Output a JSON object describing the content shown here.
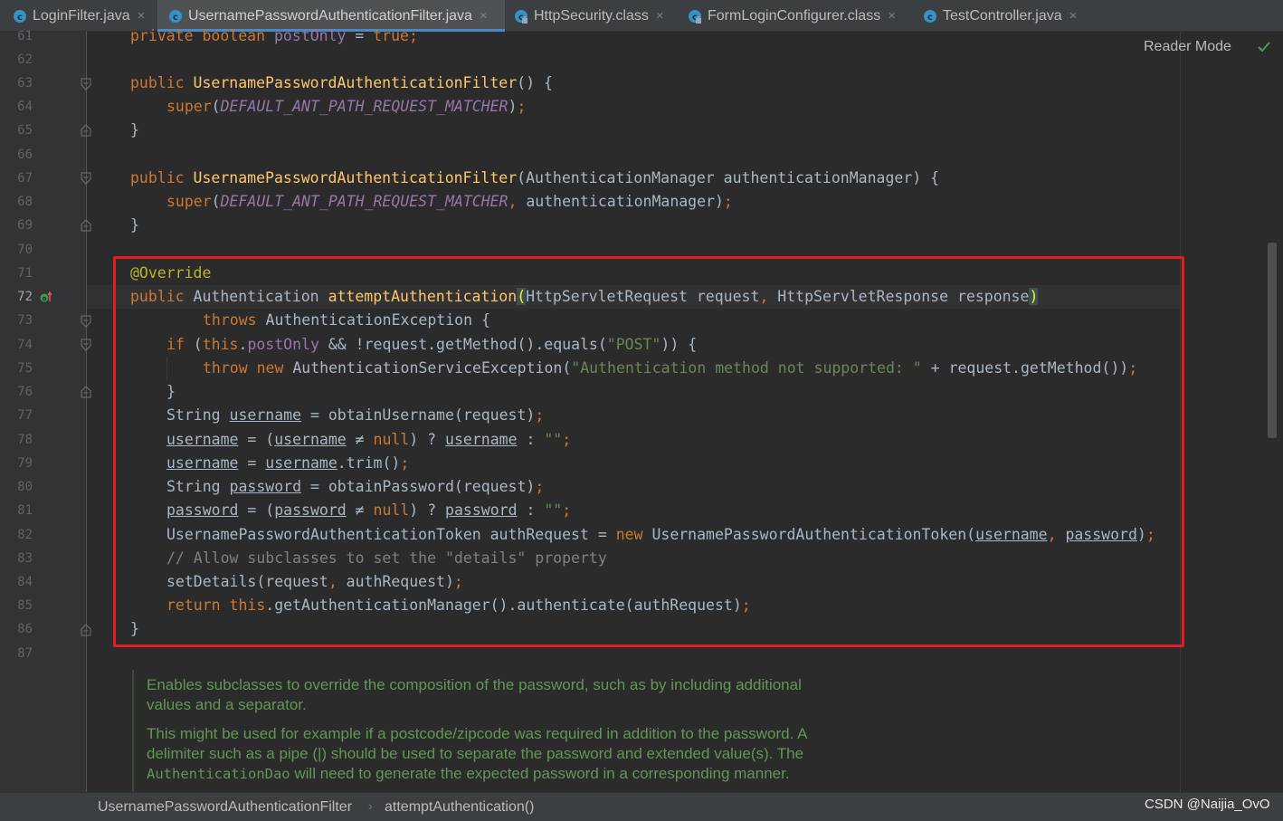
{
  "tabs": [
    {
      "label": "LoginFilter.java",
      "icon": "java-class-icon"
    },
    {
      "label": "UsernamePasswordAuthenticationFilter.java",
      "icon": "java-class-icon",
      "active": true
    },
    {
      "label": "HttpSecurity.class",
      "icon": "compiled-class-icon"
    },
    {
      "label": "FormLoginConfigurer.class",
      "icon": "compiled-class-icon"
    },
    {
      "label": "TestController.java",
      "icon": "java-class-icon"
    }
  ],
  "close_glyph": "×",
  "reader_mode": "Reader Mode",
  "current_line": "72",
  "line_numbers": [
    "61",
    "62",
    "63",
    "64",
    "65",
    "66",
    "67",
    "68",
    "69",
    "70",
    "71",
    "72",
    "73",
    "74",
    "75",
    "76",
    "77",
    "78",
    "79",
    "80",
    "81",
    "82",
    "83",
    "84",
    "85",
    "86",
    "87"
  ],
  "code": {
    "l61": {
      "kw": "private boolean",
      "fld": "postOnly",
      "op": " = ",
      "val": "true",
      "semi": ";"
    },
    "l63": {
      "kw": "public",
      "name": "UsernamePasswordAuthenticationFilter",
      "rest": "() {"
    },
    "l64": {
      "kw": "super",
      "open": "(",
      "const": "DEFAULT_ANT_PATH_REQUEST_MATCHER",
      "close": ")",
      "semi": ";"
    },
    "l65": {
      "text": "}"
    },
    "l67": {
      "kw": "public",
      "name": "UsernamePasswordAuthenticationFilter",
      "rest": "(AuthenticationManager authenticationManager) {"
    },
    "l68": {
      "kw": "super",
      "open": "(",
      "const": "DEFAULT_ANT_PATH_REQUEST_MATCHER",
      "comma": ",",
      "arg": " authenticationManager)",
      "semi": ";"
    },
    "l69": {
      "text": "}"
    },
    "l71": {
      "ann": "@Override"
    },
    "l72": {
      "kw": "public",
      "type": " Authentication ",
      "name": "attemptAuthentication",
      "open": "(",
      "params": "HttpServletRequest request",
      "comma": ",",
      "params2": " HttpServletResponse response",
      "close": ")"
    },
    "l73": {
      "kw": "throws",
      "rest": " AuthenticationException {"
    },
    "l74": {
      "kw": "if",
      "p1": " (",
      "kw2": "this",
      "dot": ".",
      "fld": "postOnly",
      "rest": " && !request.getMethod().equals(",
      "str": "\"POST\"",
      "end": ")) {"
    },
    "l75": {
      "kw": "throw new",
      "rest": " AuthenticationServiceException(",
      "str": "\"Authentication method not supported: \"",
      "rest2": " + request.getMethod())",
      "semi": ";"
    },
    "l76": {
      "text": "}"
    },
    "l77": {
      "type": "String ",
      "var": "username",
      "rest": " = obtainUsername(request)",
      "semi": ";"
    },
    "l78": {
      "var": "username",
      "eq": " = (",
      "var2": "username",
      "ne": " ≠ ",
      "kw": "null",
      "q": ") ? ",
      "var3": "username",
      "c": " : ",
      "str": "\"\"",
      "semi": ";"
    },
    "l79": {
      "var": "username",
      "eq": " = ",
      "var2": "username",
      "rest": ".trim()",
      "semi": ";"
    },
    "l80": {
      "type": "String ",
      "var": "password",
      "rest": " = obtainPassword(request)",
      "semi": ";"
    },
    "l81": {
      "var": "password",
      "eq": " = (",
      "var2": "password",
      "ne": " ≠ ",
      "kw": "null",
      "q": ") ? ",
      "var3": "password",
      "c": " : ",
      "str": "\"\"",
      "semi": ";"
    },
    "l82": {
      "decl": "UsernamePasswordAuthenticationToken authRequest = ",
      "kw": "new",
      "rest": " UsernamePasswordAuthenticationToken(",
      "var": "username",
      "comma": ",",
      "sp": " ",
      "var2": "password",
      "close": ")",
      "semi": ";"
    },
    "l83": {
      "cmt": "// Allow subclasses to set the \"details\" property"
    },
    "l84": {
      "rest": "setDetails(request",
      "comma": ",",
      "rest2": " authRequest)",
      "semi": ";"
    },
    "l85": {
      "kw": "return this",
      "rest": ".getAuthenticationManager().authenticate(authRequest)",
      "semi": ";"
    },
    "l86": {
      "text": "}"
    }
  },
  "doc": {
    "p1": "Enables subclasses to override the composition of the password, such as by including additional values and a separator.",
    "p2a": "This might be used for example if a postcode/zipcode was required in addition to the password. A delimiter such as a pipe (|) should be used to separate the password and extended value(s). The",
    "p2code": "AuthenticationDao",
    "p2b": " will need to generate the expected password in a corresponding manner."
  },
  "breadcrumb": {
    "class": "UsernamePasswordAuthenticationFilter",
    "sep": "›",
    "method": "attemptAuthentication()"
  },
  "watermark": "CSDN @Naijia_OvO",
  "colors": {
    "highlight_box": "#e31d1d",
    "keyword": "#cc7832",
    "function": "#ffc66d",
    "string": "#6a8759",
    "doc": "#629755"
  }
}
